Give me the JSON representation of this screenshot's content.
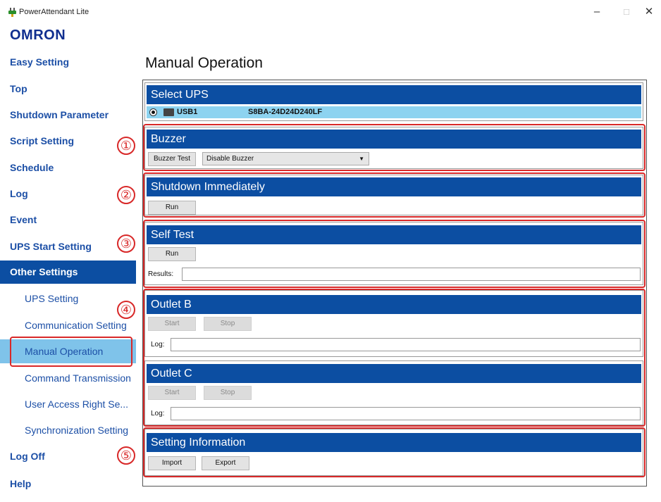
{
  "window": {
    "title": "PowerAttendant Lite",
    "minimize": "–",
    "maximize": "□",
    "close": "✕",
    "icon": "plug-icon"
  },
  "logo": "OMRON",
  "nav": {
    "easy_setting": "Easy Setting",
    "top": "Top",
    "shutdown_parameter": "Shutdown Parameter",
    "script_setting": "Script Setting",
    "schedule": "Schedule",
    "log": "Log",
    "event": "Event",
    "ups_start_setting": "UPS Start Setting",
    "other_settings": "Other Settings",
    "sub": {
      "ups_setting": "UPS Setting",
      "communication_setting": "Communication Setting",
      "manual_operation": "Manual Operation",
      "command_transmission": "Command Transmission",
      "user_access": "User Access Right Se...",
      "synchronization": "Synchronization Setting"
    },
    "log_off": "Log Off",
    "help": "Help"
  },
  "page_title": "Manual Operation",
  "select_ups": {
    "header": "Select UPS",
    "port": "USB1",
    "model": "S8BA-24D24D240LF"
  },
  "buzzer": {
    "header": "Buzzer",
    "test_button": "Buzzer Test",
    "selected_option": "Disable Buzzer"
  },
  "shutdown": {
    "header": "Shutdown Immediately",
    "run_button": "Run"
  },
  "self_test": {
    "header": "Self Test",
    "run_button": "Run",
    "results_label": "Results:",
    "results_value": ""
  },
  "outlet_b": {
    "header": "Outlet B",
    "start_button": "Start",
    "stop_button": "Stop",
    "log_label": "Log:",
    "log_value": ""
  },
  "outlet_c": {
    "header": "Outlet C",
    "start_button": "Start",
    "stop_button": "Stop",
    "log_label": "Log:",
    "log_value": ""
  },
  "setting_info": {
    "header": "Setting Information",
    "import_button": "Import",
    "export_button": "Export"
  },
  "annotations": {
    "n1": "①",
    "n2": "②",
    "n3": "③",
    "n4": "④",
    "n5": "⑤"
  },
  "colors": {
    "accent": "#0c4ea2",
    "nav_text": "#1c4fa6",
    "selected_sub": "#7fc3ea",
    "ups_row": "#8dd3f0",
    "annotation": "#d82828"
  }
}
